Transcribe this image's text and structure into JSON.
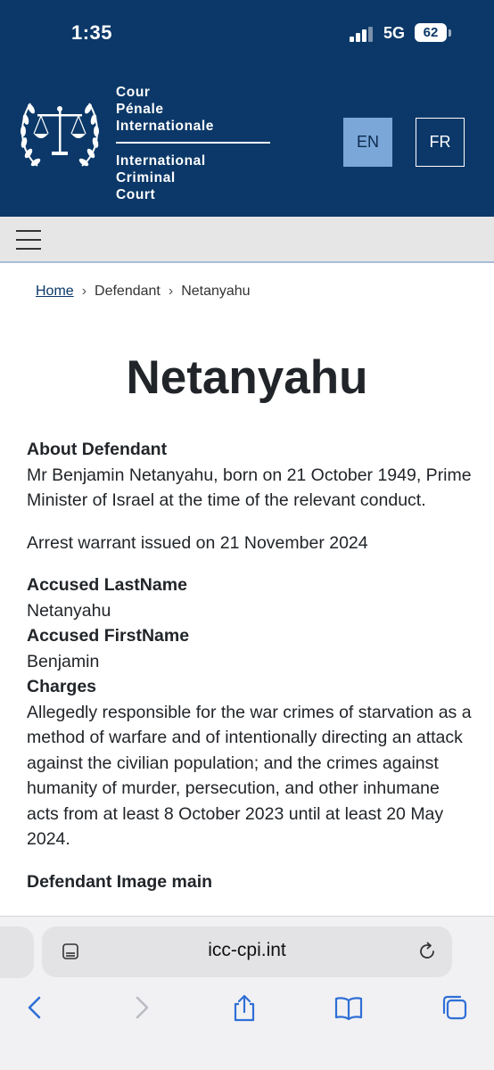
{
  "status": {
    "time": "1:35",
    "network": "5G",
    "battery": "62"
  },
  "header": {
    "brand_lines_fr": [
      "Cour",
      "Pénale",
      "Internationale"
    ],
    "brand_lines_en": [
      "International",
      "Criminal",
      "Court"
    ],
    "languages": [
      "EN",
      "FR"
    ],
    "active_language": "EN"
  },
  "menu": {
    "icon": "hamburger-menu-icon"
  },
  "breadcrumb": {
    "home": "Home",
    "section": "Defendant",
    "current": "Netanyahu"
  },
  "page": {
    "title": "Netanyahu",
    "about_label": "About Defendant",
    "about_text": "Mr Benjamin Netanyahu, born on 21 October 1949, Prime Minister of Israel at the time of the relevant conduct.",
    "warrant_text": "Arrest warrant issued on 21 November 2024",
    "lastname_label": "Accused LastName",
    "lastname_value": "Netanyahu",
    "firstname_label": "Accused FirstName",
    "firstname_value": "Benjamin",
    "charges_label": "Charges",
    "charges_text": "Allegedly responsible for the war crimes of starvation as a method of warfare and of intentionally directing an attack against the civilian population; and the crimes against humanity of murder, persecution, and other inhumane acts from at least 8 October 2023 until at least 20 May 2024.",
    "image_label": "Defendant Image main"
  },
  "browser": {
    "url": "icc-cpi.int",
    "toolbar_icons": [
      "back-icon",
      "forward-icon",
      "share-icon",
      "bookmarks-icon",
      "tabs-icon"
    ]
  },
  "colors": {
    "header_bg": "#0b3868",
    "en_button": "#7aa6d8",
    "menu_bg": "#e6e6e6",
    "ios_blue": "#2f6fd6"
  }
}
